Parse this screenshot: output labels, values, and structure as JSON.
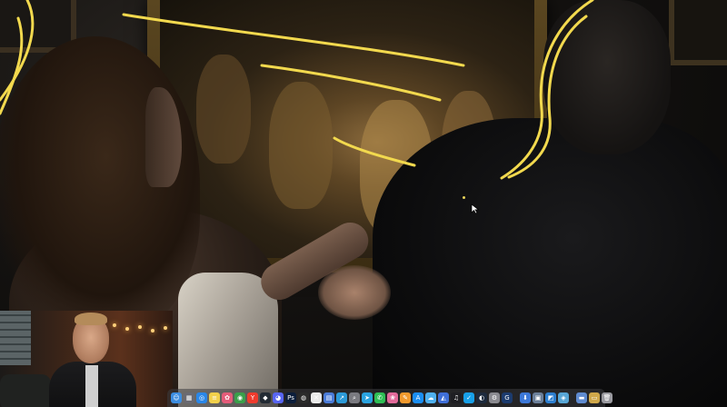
{
  "scene": {
    "description_icon": "photo-canvas"
  },
  "annotation": {
    "ink_color": "#f2d94e"
  },
  "webcam": {
    "icon": "webcam-overlay"
  },
  "dock": {
    "icons": [
      {
        "name": "finder-icon",
        "color": "#3d8de0",
        "glyph": "☺"
      },
      {
        "name": "launchpad-icon",
        "color": "#6a6a72",
        "glyph": "▦"
      },
      {
        "name": "safari-icon",
        "color": "#2a87e8",
        "glyph": "◎"
      },
      {
        "name": "notes-icon",
        "color": "#f2d04a",
        "glyph": "≡"
      },
      {
        "name": "photos-icon",
        "color": "#e45c7a",
        "glyph": "✿"
      },
      {
        "name": "chrome-icon",
        "color": "#3aa04a",
        "glyph": "◉"
      },
      {
        "name": "yandex-icon",
        "color": "#ef3b2d",
        "glyph": "Y"
      },
      {
        "name": "davinci-icon",
        "color": "#222a33",
        "glyph": "◆"
      },
      {
        "name": "discord-icon",
        "color": "#5865f2",
        "glyph": "◕"
      },
      {
        "name": "photoshop-icon",
        "color": "#0c1e3b",
        "glyph": "Ps"
      },
      {
        "name": "obs-icon",
        "color": "#2b2b2b",
        "glyph": "◍"
      },
      {
        "name": "capcut-icon",
        "color": "#eaeaea",
        "glyph": "✕"
      },
      {
        "name": "files-icon",
        "color": "#4a7bd8",
        "glyph": "▤"
      },
      {
        "name": "vpn-icon",
        "color": "#2c9ad8",
        "glyph": "↗"
      },
      {
        "name": "search-icon",
        "color": "#7a7a80",
        "glyph": "⌕"
      },
      {
        "name": "telegram-icon",
        "color": "#2aa3e0",
        "glyph": "➤"
      },
      {
        "name": "whatsapp-icon",
        "color": "#2fbf55",
        "glyph": "✆"
      },
      {
        "name": "flowers-icon",
        "color": "#e26a9a",
        "glyph": "❀"
      },
      {
        "name": "pages-icon",
        "color": "#f29a2e",
        "glyph": "✎"
      },
      {
        "name": "appstore-icon",
        "color": "#1b8ef2",
        "glyph": "A"
      },
      {
        "name": "cloud-icon",
        "color": "#4fb0ee",
        "glyph": "☁"
      },
      {
        "name": "analytics-icon",
        "color": "#3f6fd8",
        "glyph": "◭"
      },
      {
        "name": "music-icon",
        "color": "#1f1f23",
        "glyph": "♫"
      },
      {
        "name": "checkmark-icon",
        "color": "#18a0e8",
        "glyph": "✓"
      },
      {
        "name": "steam-icon",
        "color": "#1d2a3d",
        "glyph": "◐"
      },
      {
        "name": "settings-icon",
        "color": "#8a8a90",
        "glyph": "⚙"
      },
      {
        "name": "logitech-icon",
        "color": "#1c3b6e",
        "glyph": "G"
      },
      {
        "name": "separator"
      },
      {
        "name": "downloads-icon",
        "color": "#3c78d8",
        "glyph": "⬇"
      },
      {
        "name": "screenshot-icon",
        "color": "#6b7f99",
        "glyph": "▣"
      },
      {
        "name": "image-icon",
        "color": "#2d7fd0",
        "glyph": "◩"
      },
      {
        "name": "preview-icon",
        "color": "#57a6d6",
        "glyph": "◈"
      },
      {
        "name": "separator"
      },
      {
        "name": "folder-icon",
        "color": "#5f8bd0",
        "glyph": "▬"
      },
      {
        "name": "doc-icon",
        "color": "#d0a84a",
        "glyph": "▭"
      },
      {
        "name": "trash-icon",
        "color": "#9a9aa0",
        "glyph": "🗑"
      }
    ]
  }
}
